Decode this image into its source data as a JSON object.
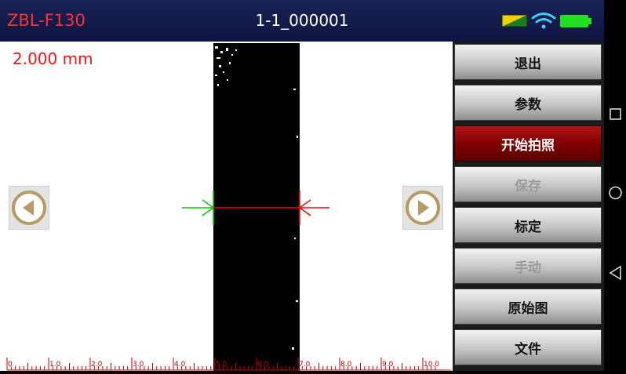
{
  "app": {
    "title": "ZBL-F130",
    "file": "1-1_000001"
  },
  "viewer": {
    "measurement": "2.000 mm",
    "ruler_labels": [
      "0",
      "1.0",
      "2.0",
      "3.0",
      "4.0",
      "5.0",
      "6.0",
      "7.0",
      "8.0",
      "9.0",
      "10.0"
    ]
  },
  "buttons": {
    "exit": "退出",
    "params": "参数",
    "capture": "开始拍照",
    "save": "保存",
    "calibrate": "标定",
    "manual": "手动",
    "original": "原始图",
    "file": "文件"
  },
  "colors": {
    "accent": "#ff3030",
    "active_button": "#8b0000",
    "left_marker": "#00cc00",
    "right_marker": "#ff0000",
    "ruler": "#cc0000"
  },
  "icons": {
    "prev": "chevron-left-circle-icon",
    "next": "chevron-right-circle-icon",
    "status": [
      "sim-card-icon",
      "wifi-icon",
      "battery-icon"
    ],
    "system_nav": [
      "recents-square-icon",
      "home-circle-icon",
      "back-triangle-icon"
    ]
  }
}
